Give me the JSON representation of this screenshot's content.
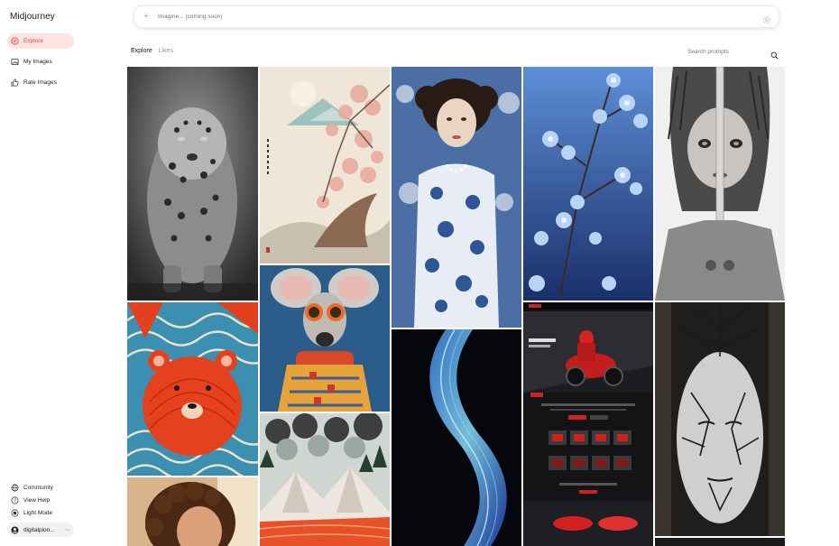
{
  "app": {
    "name": "Midjourney"
  },
  "nav": {
    "items": [
      {
        "label": "Explore",
        "icon": "explore-icon",
        "active": true
      },
      {
        "label": "My Images",
        "icon": "image-icon",
        "active": false
      },
      {
        "label": "Rate Images",
        "icon": "thumbs-up-icon",
        "active": false
      }
    ],
    "bottom": [
      {
        "label": "Community",
        "icon": "globe-icon"
      },
      {
        "label": "View Help",
        "icon": "help-icon"
      },
      {
        "label": "Light Mode",
        "icon": "sun-icon"
      }
    ],
    "user": {
      "name": "digitalpion...",
      "more": "···"
    }
  },
  "imagine": {
    "placeholder": "Imagine... (coming soon)"
  },
  "tabs": [
    {
      "label": "Explore",
      "active": true
    },
    {
      "label": "Likes",
      "active": false
    }
  ],
  "search": {
    "placeholder": "Search prompts"
  },
  "gallery": [
    {
      "subject": "leopard"
    },
    {
      "subject": "cherry-blossom-painting"
    },
    {
      "subject": "porcelain-woman"
    },
    {
      "subject": "blue-flowers"
    },
    {
      "subject": "sword-warrior"
    },
    {
      "subject": "red-bear"
    },
    {
      "subject": "mouse-with-glasses"
    },
    {
      "subject": "blue-wave"
    },
    {
      "subject": "motorcycle-website"
    },
    {
      "subject": "tree-face"
    },
    {
      "subject": "curly-hair-woman"
    },
    {
      "subject": "mountain-landscape"
    }
  ],
  "colors": {
    "accent": "#e5463b",
    "active_bg": "#fde3e1"
  }
}
